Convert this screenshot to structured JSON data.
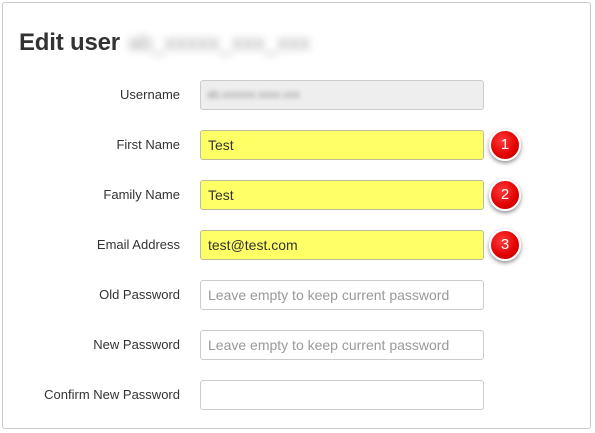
{
  "header": {
    "title": "Edit user",
    "blurred_username": "ab_xxxxx_xxx_xxx"
  },
  "form": {
    "username": {
      "label": "Username",
      "value": "ab.xxxxxx.xxxx.xxx",
      "disabled": true
    },
    "first_name": {
      "label": "First Name",
      "value": "Test",
      "highlighted": true,
      "callout": "1"
    },
    "family_name": {
      "label": "Family Name",
      "value": "Test",
      "highlighted": true,
      "callout": "2"
    },
    "email": {
      "label": "Email Address",
      "value": "test@test.com",
      "highlighted": true,
      "callout": "3"
    },
    "old_password": {
      "label": "Old Password",
      "value": "",
      "placeholder": "Leave empty to keep current password"
    },
    "new_password": {
      "label": "New Password",
      "value": "",
      "placeholder": "Leave empty to keep current password"
    },
    "confirm_password": {
      "label": "Confirm New Password",
      "value": "",
      "placeholder": ""
    }
  },
  "colors": {
    "highlight": "#ffff66",
    "callout_badge": "#e00000",
    "text": "#333333",
    "placeholder": "#999999"
  }
}
